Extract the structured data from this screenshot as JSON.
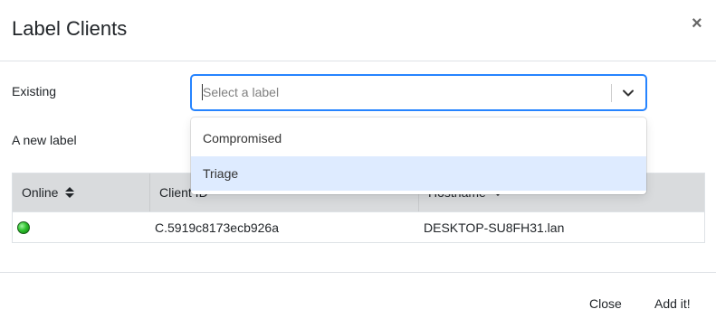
{
  "modal": {
    "title": "Label Clients",
    "close_symbol": "×"
  },
  "form": {
    "existing_label": "Existing",
    "select_placeholder": "Select a label",
    "new_label": "A new label"
  },
  "dropdown": {
    "options": [
      "Compromised",
      "Triage"
    ],
    "highlighted_index": 1
  },
  "table": {
    "headers": {
      "online": "Online",
      "client_id": "Client ID",
      "hostname": "Hostname"
    },
    "rows": [
      {
        "online": "online",
        "client_id": "C.5919c8173ecb926a",
        "hostname": "DESKTOP-SU8FH31.lan"
      }
    ]
  },
  "footer": {
    "close_label": "Close",
    "add_label": "Add it!"
  },
  "colors": {
    "focus_border": "#2684ff",
    "option_highlight": "#deebff",
    "table_header_bg": "#d9dbdd",
    "online_green": "#2fc12f"
  }
}
